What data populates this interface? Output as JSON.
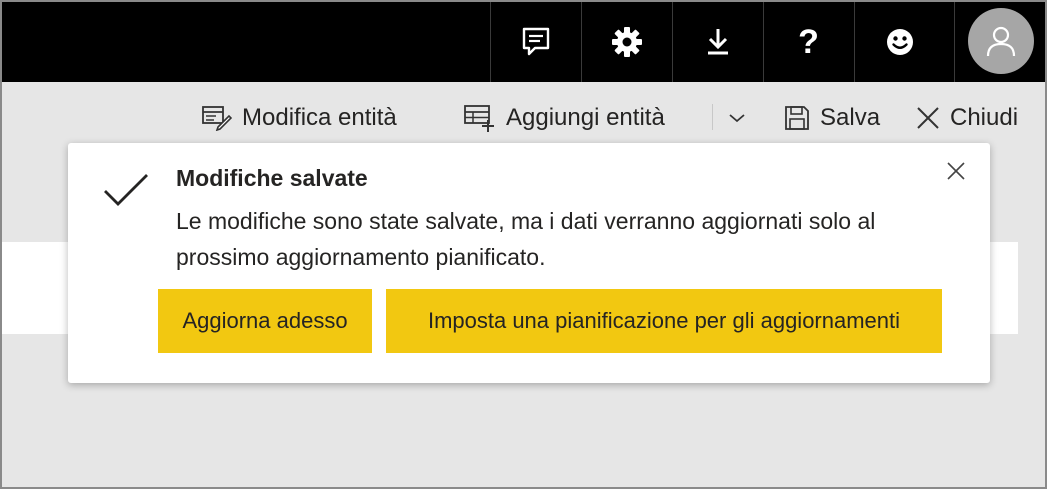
{
  "topbar": {
    "icons": [
      "feedback-icon",
      "gear-icon",
      "download-icon",
      "help-icon",
      "smiley-icon",
      "user-avatar-icon"
    ]
  },
  "ribbon": {
    "edit_entities": "Modifica entità",
    "add_entities": "Aggiungi entità",
    "save": "Salva",
    "close": "Chiudi"
  },
  "toast": {
    "title": "Modifiche salvate",
    "message": "Le modifiche sono state salvate, ma i dati verranno aggiornati solo al prossimo aggiornamento pianificato.",
    "refresh_now": "Aggiorna adesso",
    "set_schedule": "Imposta una pianificazione per gli aggiornamenti"
  },
  "colors": {
    "accent": "#f2c811",
    "topbar": "#000000",
    "background": "#e6e6e6"
  }
}
